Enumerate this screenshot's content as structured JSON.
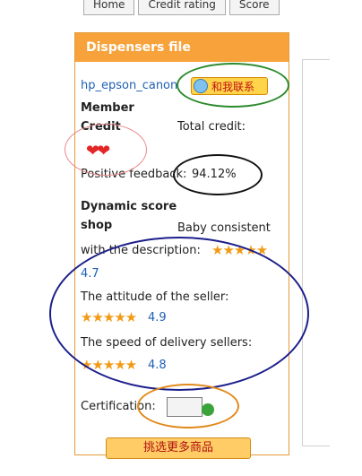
{
  "tabs": [
    "Home",
    "Credit rating",
    "Score"
  ],
  "panel": {
    "title": "Dispensers file"
  },
  "seller": {
    "name": "hp_epson_canon",
    "chat_label": "和我联系"
  },
  "member_credit": {
    "label": "Member Credit",
    "total_label": "Total credit:"
  },
  "feedback": {
    "label": "Positive feedback:",
    "value": "94.12%"
  },
  "dynamic": {
    "label": "Dynamic score shop",
    "baby_label": "Baby consistent",
    "desc_label": "with the description:",
    "desc_value": "4.7",
    "attitude_label": "The attitude of the seller:",
    "attitude_value": "4.9",
    "speed_label": "The speed of delivery sellers:",
    "speed_value": "4.8",
    "stars": "★★★★★"
  },
  "certification": {
    "label": "Certification:"
  },
  "bottom_button": {
    "label": "挑选更多商品"
  },
  "colors": {
    "orange": "#f7a23a",
    "link": "#1f5fb7",
    "star": "#f29a14"
  }
}
